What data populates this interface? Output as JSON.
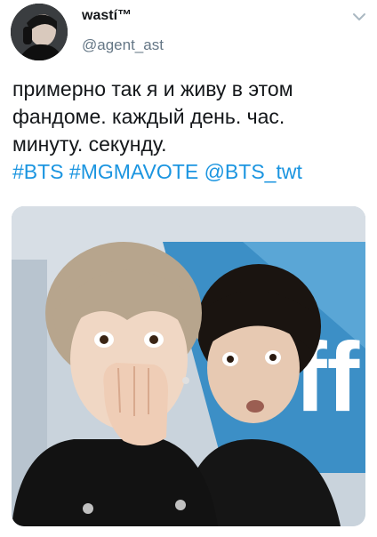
{
  "user": {
    "display_name": "ᴡastí™",
    "handle": "@agent_ast"
  },
  "tweet": {
    "lines": [
      "примерно так я и живу в этом",
      "фандоме. каждый день. час.",
      "минуту. секунду."
    ],
    "hashtags": [
      "#BTS",
      "#MGMAVOTE",
      "@BTS_twt"
    ]
  },
  "media": {
    "backdrop_text": "ff"
  },
  "colors": {
    "link": "#1b95e0",
    "secondary": "#657786"
  },
  "icons": [
    "avatar",
    "chevron-down-icon"
  ]
}
